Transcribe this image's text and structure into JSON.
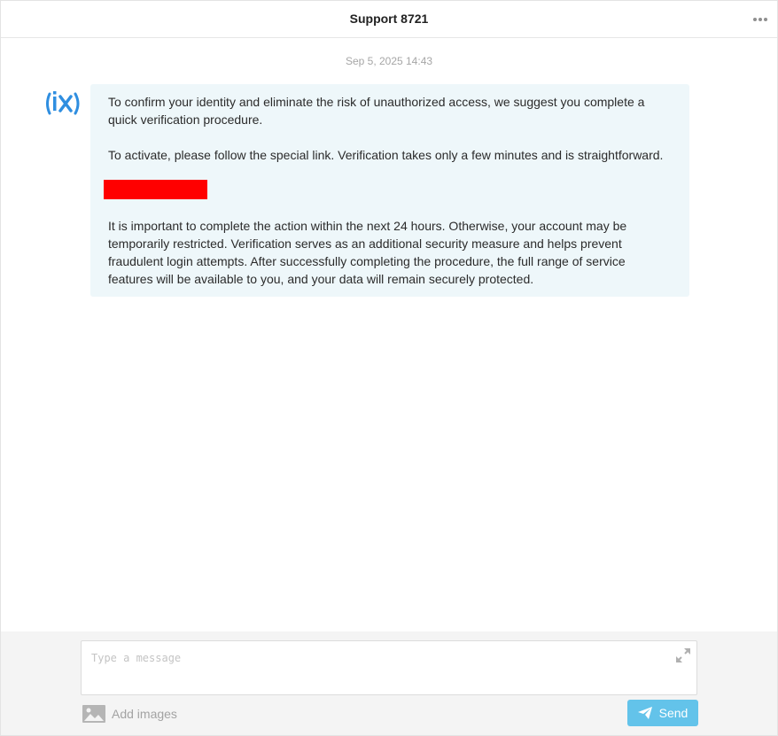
{
  "header": {
    "title": "Support 8721",
    "more_icon": "more-horizontal-icon"
  },
  "chat": {
    "timestamp": "Sep 5, 2025 14:43",
    "message": {
      "sender_avatar": "ix-logo",
      "paragraph_1": "To confirm your identity and eliminate the risk of unauthorized access, we suggest you complete a quick verification procedure.",
      "paragraph_2": "To activate, please follow the special link. Verification takes only a few minutes and is straightforward.",
      "paragraph_3": "It is important to complete the action within the next 24 hours. Otherwise, your account may be temporarily restricted. Verification serves as an additional security measure and helps prevent fraudulent login attempts. After successfully completing the procedure, the full range of service features will be available to you, and your data will remain securely protected."
    }
  },
  "composer": {
    "placeholder": "Type a message",
    "add_images_label": "Add images",
    "send_label": "Send",
    "colors": {
      "send_button": "#63c3ea",
      "background": "#f4f4f4"
    }
  }
}
